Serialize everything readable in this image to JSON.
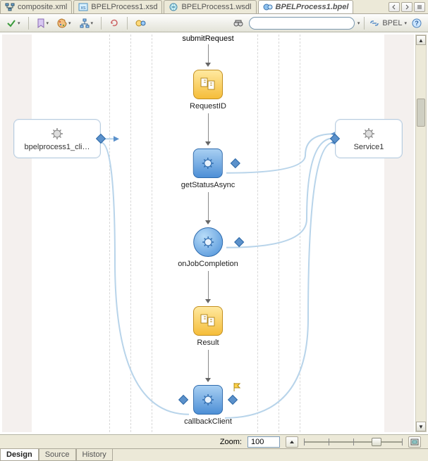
{
  "tabs": [
    {
      "label": "composite.xml",
      "icon": "tree-icon"
    },
    {
      "label": "BPELProcess1.xsd",
      "icon": "xsd-icon"
    },
    {
      "label": "BPELProcess1.wsdl",
      "icon": "wsdl-icon"
    },
    {
      "label": "BPELProcess1.bpel",
      "icon": "bpel-icon",
      "active": true
    }
  ],
  "toolbar": {
    "search_placeholder": "",
    "view_label": "BPEL"
  },
  "canvas": {
    "partners": {
      "left": {
        "label": "bpelprocess1_cli…"
      },
      "right": {
        "label": "Service1"
      }
    },
    "flow": [
      {
        "id": "submitRequest",
        "type": "label",
        "label": "submitRequest"
      },
      {
        "id": "RequestID",
        "type": "assign",
        "label": "RequestID"
      },
      {
        "id": "getStatusAsync",
        "type": "invoke",
        "label": "getStatusAsync"
      },
      {
        "id": "onJobCompletion",
        "type": "receive",
        "label": "onJobCompletion"
      },
      {
        "id": "Result",
        "type": "assign",
        "label": "Result"
      },
      {
        "id": "callbackClient",
        "type": "invoke",
        "label": "callbackClient",
        "flag": true
      }
    ]
  },
  "zoom": {
    "label": "Zoom:",
    "value": "100"
  },
  "subtabs": [
    {
      "label": "Design",
      "active": true
    },
    {
      "label": "Source"
    },
    {
      "label": "History"
    }
  ]
}
